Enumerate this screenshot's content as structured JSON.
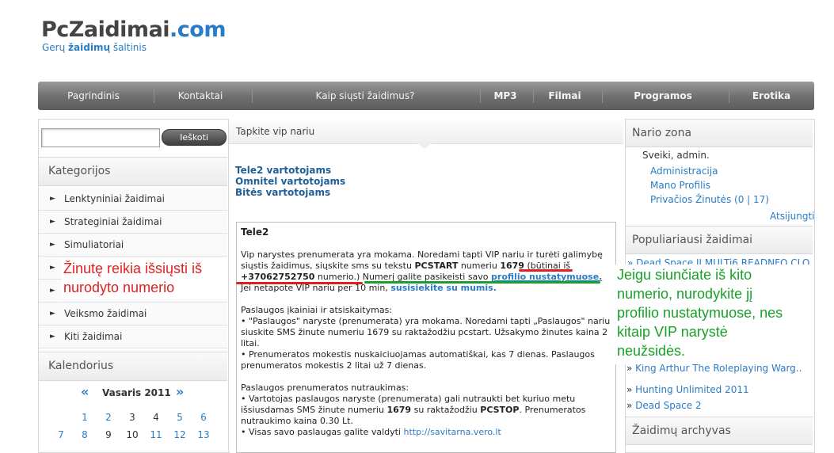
{
  "site": {
    "logo_pc": "Pc",
    "logo_name": "Zaidimai",
    "logo_tld": ".com",
    "tagline_pre": "Gerų ",
    "tagline_bold": "žaidimų",
    "tagline_post": " šaltinis",
    "brand_color": "#2a7cc7"
  },
  "nav": {
    "items": [
      "Pagrindinis",
      "Kontaktai",
      "Kaip siųsti žaidimus?",
      "MP3",
      "Filmai",
      "Programos",
      "Erotika"
    ]
  },
  "search": {
    "placeholder": "",
    "button": "Ieškoti"
  },
  "categories": {
    "title": "Kategorijos",
    "items": [
      "Lenktyniniai žaidimai",
      "Strateginiai žaidimai",
      "Simuliatoriai",
      "",
      "",
      "Veiksmo žaidimai",
      "Kiti žaidimai"
    ]
  },
  "calendar": {
    "title": "Kalendorius",
    "prev": "«",
    "month": "Vasaris 2011",
    "next": "»",
    "row1": [
      "1",
      "2",
      "3",
      "4",
      "5",
      "6"
    ],
    "row2": [
      "7",
      "8",
      "9",
      "10",
      "11",
      "12",
      "13"
    ]
  },
  "center": {
    "title": "Tapkite vip nariu",
    "links": [
      "Tele2 vartotojams",
      "Omnitel vartotojams",
      "Bitės vartotojams"
    ],
    "box_title": "Tele2",
    "p1_l1": "Vip narystes prenumerata yra mokama. Noredami tapti VIP nariu ir turėti galimybę",
    "p1_l2_a": "siųstis žaidimus, siųskite sms su tekstu ",
    "p1_l2_b": "PCSTART",
    "p1_l2_c": " numeriu ",
    "p1_l2_d": "1679",
    "p1_l2_e": " (būtinai iš",
    "p1_l3_a": "+37062752750",
    "p1_l3_b": " numerio.) Numerį galite pasikeisti savo ",
    "p1_l3_c": "profilio nustatymuose.",
    "p1_l4_a": "Jei netapote VIP nariu per 10 min, ",
    "p1_l4_b": "susisiekite su mumis.",
    "p2_title": "Paslaugos įkainiai ir atsiskaitymas:",
    "p2_l1": "• \"Paslaugos\" naryste (prenumerata) yra mokama. Noredami tapti „Paslaugos\" nariu",
    "p2_l2": "siuskite SMS žinute numeriu 1679 su raktažodžiu pcstart. Užsakymo žinutes kaina 2",
    "p2_l3": "litai.",
    "p2_l4": "• Prenumeratos mokestis nuskaiciuojamas automatiškai, kas 7 dienas. Paslaugos",
    "p2_l5": "prenumeratos mokestis 2 litai už 7 dienas.",
    "p3_title": "Paslaugos prenumeratos nutraukimas:",
    "p3_l1": "• Vartotojas paslaugos naryste (prenumerata) gali nutraukti bet kuriuo metu",
    "p3_l2_a": "išsiusdamas SMS žinute numeriu ",
    "p3_l2_b": "1679",
    "p3_l2_c": " su raktažodžiu ",
    "p3_l2_d": "PCSTOP",
    "p3_l2_e": ". Prenumeratos",
    "p3_l3": "nutraukimo kaina 0.30 Lt.",
    "p3_l4_a": "• Visas savo paslaugas galite valdyti ",
    "p3_l4_b": "http://savitarna.vero.lt"
  },
  "member": {
    "title": "Nario zona",
    "greeting": "Sveiki, admin.",
    "links": [
      "Administracija",
      "Mano Profilis",
      "Privačios Žinutės (0 | 17)"
    ],
    "logout": "Atsijungti"
  },
  "popular": {
    "title": "Populiariausi žaidimai",
    "top": "» Dead Space II MULTi6 READNFO CLO",
    "items": [
      "King Arthur The Roleplaying Warg..",
      "Hunting Unlimited 2011",
      "Dead Space 2"
    ],
    "bullet": "»"
  },
  "archive": {
    "title": "Žaidimų archyvas"
  },
  "annotations": {
    "red_l1": "Žinutę reikia išsiųsti iš",
    "red_l2": "nurodyto numerio",
    "green_l1": "Jeigu siunčiate iš kito",
    "green_l2": "numerio, nurodykite jį",
    "green_l3": "profilio nustatymuose, nes",
    "green_l4": "kitaip VIP narystė",
    "green_l5": "neužsidės.",
    "red_color": "#e02020",
    "green_color": "#1aa02a"
  }
}
